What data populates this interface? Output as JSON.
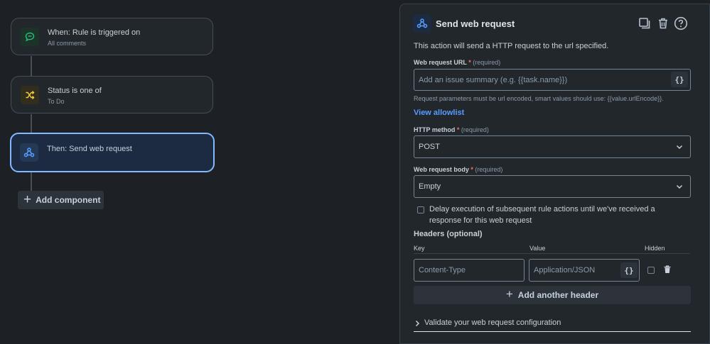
{
  "flow": {
    "nodes": [
      {
        "title": "When: Rule is triggered on",
        "subtitle": "All comments",
        "icon": "comment-icon",
        "color": "#2abb7f"
      },
      {
        "title": "Status is one of",
        "subtitle": "To Do",
        "icon": "shuffle-icon",
        "color": "#f5cd47"
      },
      {
        "title": "Then: Send web request",
        "subtitle": "",
        "icon": "webhook-icon",
        "color": "#579dff"
      }
    ],
    "add_component_label": "Add component"
  },
  "panel": {
    "title": "Send web request",
    "description": "This action will send a HTTP request to the url specified.",
    "url": {
      "label": "Web request URL",
      "required_mark": "*",
      "required_text": "(required)",
      "placeholder": "Add an issue summary (e.g. {{task.name}})",
      "smart_value_button": "{}"
    },
    "hint": "Request parameters must be url encoded, smart values should use: {{value.urlEncode}}.",
    "allowlist_link": "View allowlist",
    "method": {
      "label": "HTTP method",
      "required_mark": "*",
      "required_text": "(required)",
      "value": "POST"
    },
    "body": {
      "label": "Web request body",
      "required_mark": "*",
      "required_text": "(required)",
      "value": "Empty"
    },
    "delay_checkbox": {
      "checked": false,
      "label": "Delay execution of subsequent rule actions until we've received a response for this web request"
    },
    "headers": {
      "title": "Headers (optional)",
      "col_key": "Key",
      "col_value": "Value",
      "col_hidden": "Hidden",
      "key_placeholder": "Content-Type",
      "value_placeholder": "Application/JSON",
      "smart_value_button": "{}",
      "add_label": "Add another header"
    },
    "validate_label": "Validate your web request configuration"
  }
}
